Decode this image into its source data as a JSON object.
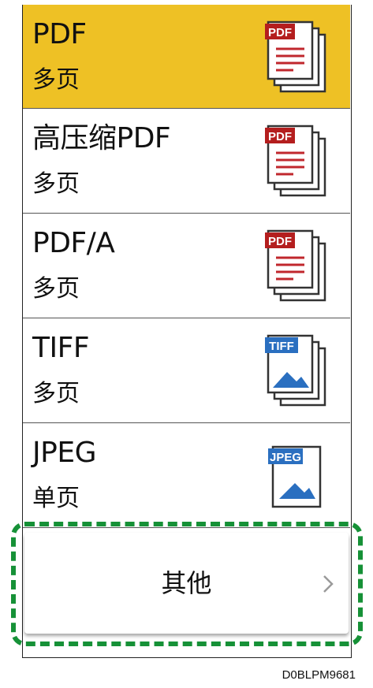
{
  "file_type_list": {
    "items": [
      {
        "name": "PDF",
        "pages": "多页",
        "badge": "PDF",
        "selected": true,
        "icon": "pdf-multipage-icon"
      },
      {
        "name": "高压缩PDF",
        "pages": "多页",
        "badge": "PDF",
        "selected": false,
        "icon": "pdf-multipage-icon"
      },
      {
        "name": "PDF/A",
        "pages": "多页",
        "badge": "PDF",
        "selected": false,
        "icon": "pdf-multipage-icon"
      },
      {
        "name": "TIFF",
        "pages": "多页",
        "badge": "TIFF",
        "selected": false,
        "icon": "tiff-multipage-icon"
      },
      {
        "name": "JPEG",
        "pages": "单页",
        "badge": "JPEG",
        "selected": false,
        "icon": "jpeg-singlepage-icon"
      }
    ],
    "other_button": {
      "label": "其他",
      "chevron_icon": "chevron-right-icon"
    }
  },
  "figure_code": "D0BLPM9681",
  "colors": {
    "selected_bg": "#eec125",
    "pdf_badge": "#b41e1e",
    "image_badge": "#2a6fc0",
    "highlight_dash": "#169137"
  }
}
